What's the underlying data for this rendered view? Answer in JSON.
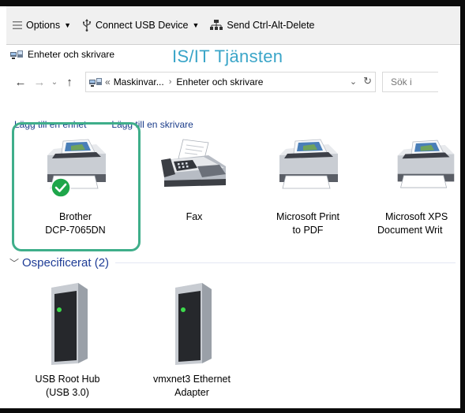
{
  "toolbar": {
    "options_label": "Options",
    "usb_label": "Connect USB Device",
    "cad_label": "Send Ctrl-Alt-Delete"
  },
  "window": {
    "title": "Enheter och skrivare",
    "watermark": "IS/IT Tjänsten"
  },
  "address": {
    "prefix": "«",
    "crumb1": "Maskinvar...",
    "crumb2": "Enheter och skrivare",
    "search_placeholder": "Sök i"
  },
  "commands": {
    "add_device": "Lägg till en enhet",
    "add_printer": "Lägg till en skrivare"
  },
  "printers": [
    {
      "line1": "Brother",
      "line2": "DCP-7065DN",
      "default": true
    },
    {
      "line1": "Fax",
      "line2": ""
    },
    {
      "line1": "Microsoft Print",
      "line2": "to PDF"
    },
    {
      "line1": "Microsoft XPS",
      "line2": "Document Writ"
    }
  ],
  "group": {
    "label": "Ospecificerat (2)"
  },
  "devices": [
    {
      "line1": "USB Root Hub",
      "line2": "(USB 3.0)"
    },
    {
      "line1": "vmxnet3 Ethernet",
      "line2": "Adapter"
    }
  ],
  "colors": {
    "accent": "#3fae8a",
    "watermark": "#3aa5c8",
    "group_header": "#1e3c96",
    "default_check": "#1ea64a"
  }
}
